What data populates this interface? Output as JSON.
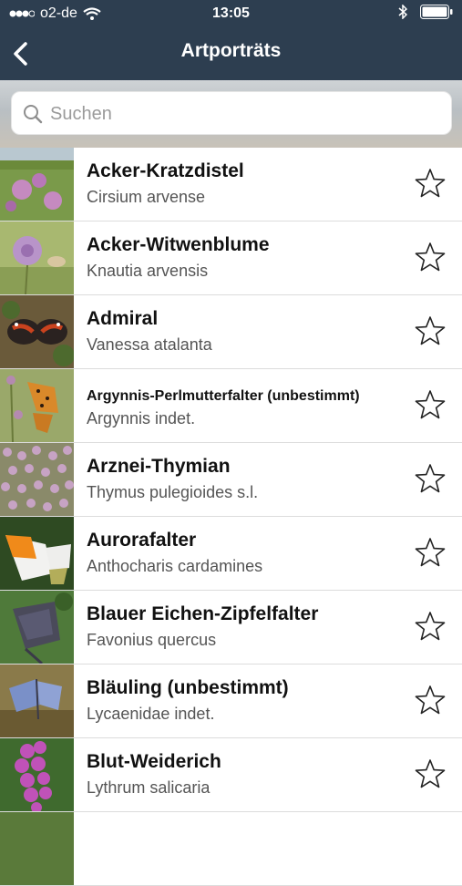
{
  "status": {
    "carrier": "o2-de",
    "time": "13:05"
  },
  "nav": {
    "title": "Artporträts"
  },
  "search": {
    "placeholder": "Suchen"
  },
  "species": [
    {
      "name": "Acker-Kratzdistel",
      "scientific": "Cirsium arvense",
      "thumb": "thistle"
    },
    {
      "name": "Acker-Witwenblume",
      "scientific": "Knautia arvensis",
      "thumb": "scabious"
    },
    {
      "name": "Admiral",
      "scientific": "Vanessa atalanta",
      "thumb": "red-admiral"
    },
    {
      "name": "Argynnis-Perlmutterfalter (unbestimmt)",
      "scientific": "Argynnis indet.",
      "thumb": "fritillary"
    },
    {
      "name": "Arznei-Thymian",
      "scientific": "Thymus pulegioides s.l.",
      "thumb": "thyme"
    },
    {
      "name": "Aurorafalter",
      "scientific": "Anthocharis cardamines",
      "thumb": "orange-tip"
    },
    {
      "name": "Blauer Eichen-Zipfelfalter",
      "scientific": "Favonius quercus",
      "thumb": "hairstreak"
    },
    {
      "name": "Bläuling (unbestimmt)",
      "scientific": "Lycaenidae indet.",
      "thumb": "blue-butterfly"
    },
    {
      "name": "Blut-Weiderich",
      "scientific": "Lythrum salicaria",
      "thumb": "loosestrife"
    }
  ]
}
